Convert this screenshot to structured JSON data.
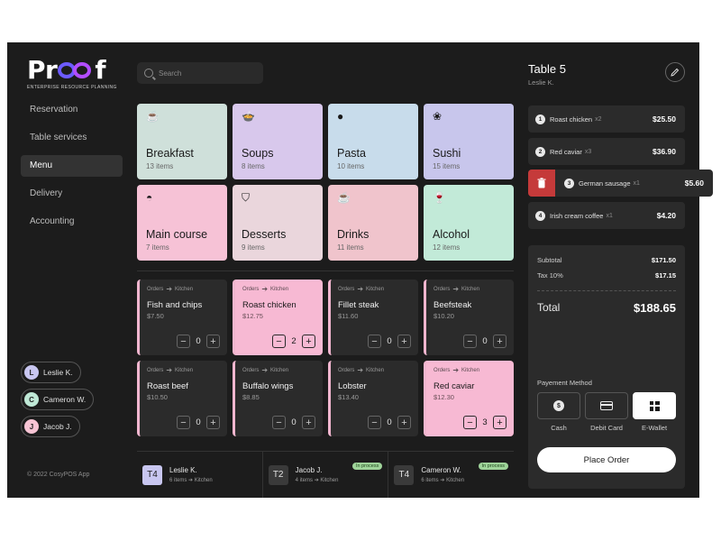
{
  "brand": {
    "logo_text_left": "Pr",
    "logo_text_right": "f",
    "tagline": "ENTERPRISE RESOURCE PLANNING"
  },
  "nav": {
    "items": [
      {
        "label": "Reservation"
      },
      {
        "label": "Table services"
      },
      {
        "label": "Menu",
        "active": true
      },
      {
        "label": "Delivery"
      },
      {
        "label": "Accounting"
      }
    ]
  },
  "staff": [
    {
      "initial": "L",
      "name": "Leslie K.",
      "color": "#c8c6f0"
    },
    {
      "initial": "C",
      "name": "Cameron W.",
      "color": "#bfe8d6"
    },
    {
      "initial": "J",
      "name": "Jacob J.",
      "color": "#f7c4d4"
    }
  ],
  "copyright": "© 2022 CosyPOS App",
  "search": {
    "placeholder": "Search"
  },
  "categories": [
    {
      "name": "Breakfast",
      "count": "13 items",
      "color": "#cfe0da",
      "icon": "coffee-cup-icon",
      "glyph": "☕"
    },
    {
      "name": "Soups",
      "count": "8 items",
      "color": "#d8c8ec",
      "icon": "soup-bowl-icon",
      "glyph": "🍲"
    },
    {
      "name": "Pasta",
      "count": "10 items",
      "color": "#c8dceb",
      "icon": "pasta-plate-icon",
      "glyph": "●"
    },
    {
      "name": "Sushi",
      "count": "15 items",
      "color": "#c8c6ec",
      "icon": "sushi-icon",
      "glyph": "❀"
    },
    {
      "name": "Main course",
      "count": "7 items",
      "color": "#f6c2d6",
      "icon": "cloche-icon",
      "glyph": "◓"
    },
    {
      "name": "Desserts",
      "count": "9 items",
      "color": "#ead6dc",
      "icon": "cupcake-icon",
      "glyph": "⛉"
    },
    {
      "name": "Drinks",
      "count": "11 items",
      "color": "#f0c4cc",
      "icon": "mug-icon",
      "glyph": "☕"
    },
    {
      "name": "Alcohol",
      "count": "12 items",
      "color": "#c2ead8",
      "icon": "wine-glass-icon",
      "glyph": "🍷"
    }
  ],
  "route": {
    "from": "Orders",
    "to": "Kitchen"
  },
  "items": [
    {
      "name": "Fish and chips",
      "price": "$7.50",
      "qty": "0",
      "selected": false
    },
    {
      "name": "Roast chicken",
      "price": "$12.75",
      "qty": "2",
      "selected": true
    },
    {
      "name": "Fillet steak",
      "price": "$11.60",
      "qty": "0",
      "selected": false
    },
    {
      "name": "Beefsteak",
      "price": "$10.20",
      "qty": "0",
      "selected": false
    },
    {
      "name": "Roast beef",
      "price": "$10.50",
      "qty": "0",
      "selected": false
    },
    {
      "name": "Buffalo wings",
      "price": "$8.85",
      "qty": "0",
      "selected": false
    },
    {
      "name": "Lobster",
      "price": "$13.40",
      "qty": "0",
      "selected": false
    },
    {
      "name": "Red caviar",
      "price": "$12.30",
      "qty": "3",
      "selected": true
    }
  ],
  "tables": [
    {
      "id": "T4",
      "name": "Leslie K.",
      "items": "6 items",
      "dest": "Kitchen",
      "status": "",
      "highlight": true
    },
    {
      "id": "T2",
      "name": "Jacob J.",
      "items": "4 items",
      "dest": "Kitchen",
      "status": "In process",
      "highlight": false
    },
    {
      "id": "T4",
      "name": "Cameron W.",
      "items": "6 items",
      "dest": "Kitchen",
      "status": "In process",
      "highlight": false
    }
  ],
  "panel": {
    "title": "Table 5",
    "subtitle": "Leslie K."
  },
  "orders": [
    {
      "num": "1",
      "name": "Roast chicken",
      "qty": "x2",
      "price": "$25.50"
    },
    {
      "num": "2",
      "name": "Red caviar",
      "qty": "x3",
      "price": "$36.90"
    },
    {
      "num": "3",
      "name": "German sausage",
      "qty": "x1",
      "price": "$5.60"
    },
    {
      "num": "4",
      "name": "Irish cream coffee",
      "qty": "x1",
      "price": "$4.20"
    }
  ],
  "summary": {
    "subtotal_label": "Subtotal",
    "subtotal": "$171.50",
    "tax_label": "Tax 10%",
    "tax": "$17.15",
    "total_label": "Total",
    "total": "$188.65"
  },
  "payment": {
    "label": "Payement Method",
    "methods": [
      {
        "label": "Cash",
        "active": false
      },
      {
        "label": "Debit Card",
        "active": false
      },
      {
        "label": "E-Wallet",
        "active": true
      }
    ],
    "place_order": "Place Order"
  },
  "colors": {
    "background": "#1c1c1c",
    "card": "#2b2b2b",
    "accent_pink": "#f7b9d3",
    "danger": "#c53a3a",
    "status_green": "#9fd49a",
    "brand_purple": "#9b4dff"
  }
}
